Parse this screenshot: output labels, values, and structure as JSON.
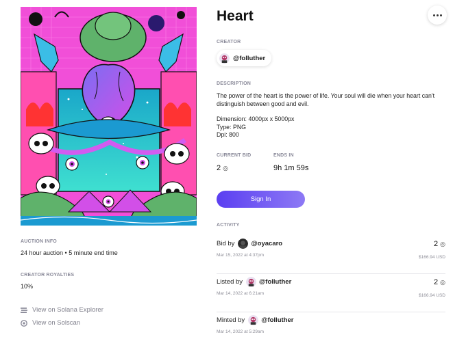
{
  "nft": {
    "title": "Heart",
    "more_icon": "more-horizontal-icon"
  },
  "creator": {
    "label": "CREATOR",
    "handle": "@folluther"
  },
  "description": {
    "label": "DESCRIPTION",
    "text": "The power of the heart is the power of life. Your soul will die when your heart can't distinguish between good and evil.",
    "dimension": "Dimension: 4000px x 5000px",
    "type": "Type: PNG",
    "dpi": "Dpi: 800"
  },
  "auction": {
    "current_bid_label": "CURRENT BID",
    "current_bid_value": "2",
    "ends_in_label": "ENDS IN",
    "ends_in_value": "9h 1m 59s",
    "currency_symbol": "◎"
  },
  "signin_label": "Sign In",
  "activity": {
    "label": "ACTIVITY",
    "items": [
      {
        "action": "Bid by",
        "user": "@oyacaro",
        "date": "Mar 15, 2022 at 4:37pm",
        "amount": "2",
        "usd": "$166.94 USD"
      },
      {
        "action": "Listed by",
        "user": "@folluther",
        "date": "Mar 14, 2022 at 6:21am",
        "amount": "2",
        "usd": "$166.94 USD"
      },
      {
        "action": "Minted by",
        "user": "@folluther",
        "date": "Mar 14, 2022 at 5:29am",
        "amount": "",
        "usd": ""
      }
    ]
  },
  "left_meta": {
    "auction_info_label": "AUCTION INFO",
    "auction_info_value": "24 hour auction • 5 minute end time",
    "royalties_label": "CREATOR ROYALTIES",
    "royalties_value": "10%",
    "link_explorer": "View on Solana Explorer",
    "link_solscan": "View on Solscan"
  },
  "colors": {
    "accent_start": "#5b3ff1",
    "accent_end": "#8d79f5",
    "art_pink": "#f14fd8",
    "art_teal": "#19c3d8",
    "art_green": "#5fb26b"
  }
}
